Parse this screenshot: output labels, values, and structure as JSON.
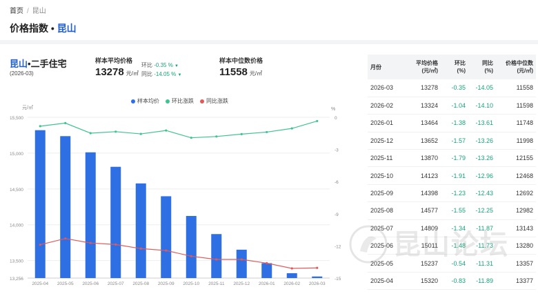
{
  "breadcrumb": {
    "home": "首页",
    "sep": "/",
    "current": "昆山"
  },
  "page_title": {
    "prefix": "价格指数 • ",
    "city": "昆山"
  },
  "city_block": {
    "city": "昆山",
    "type": "•二手住宅",
    "date": "(2026-03)"
  },
  "avg_price": {
    "label": "样本平均价格",
    "value": "13278",
    "unit": "元/㎡",
    "mom_label": "环比",
    "mom_value": "-0.35 %",
    "yoy_label": "同比",
    "yoy_value": "-14.05 %"
  },
  "median_price": {
    "label": "样本中位数价格",
    "value": "11558",
    "unit": "元/㎡"
  },
  "legend": {
    "avg": "样本均价",
    "mom": "环比涨跌",
    "yoy": "同比涨跌"
  },
  "colors": {
    "bar": "#2f6fe4",
    "mom": "#3fc38f",
    "yoy": "#e05a5a",
    "accent": "#1f5fd1"
  },
  "chart_data": {
    "type": "bar",
    "categories": [
      "2025-04",
      "2025-05",
      "2025-06",
      "2025-07",
      "2025-08",
      "2025-09",
      "2025-10",
      "2025-11",
      "2025-12",
      "2026-01",
      "2026-02",
      "2026-03"
    ],
    "series": [
      {
        "name": "样本均价",
        "type": "bar",
        "axis": "left",
        "values": [
          15320,
          15237,
          15011,
          14809,
          14577,
          14398,
          14123,
          13870,
          13652,
          13464,
          13324,
          13278
        ]
      },
      {
        "name": "环比涨跌",
        "type": "line",
        "axis": "right",
        "values": [
          -0.83,
          -0.54,
          -1.48,
          -1.34,
          -1.55,
          -1.23,
          -1.91,
          -1.79,
          -1.57,
          -1.38,
          -1.04,
          -0.35
        ]
      },
      {
        "name": "同比涨跌",
        "type": "line",
        "axis": "right",
        "values": [
          -11.89,
          -11.31,
          -11.73,
          -11.87,
          -12.25,
          -12.43,
          -12.96,
          -13.26,
          -13.26,
          -13.61,
          -14.1,
          -14.05
        ]
      }
    ],
    "left_axis": {
      "unit": "元/㎡",
      "min": 13256,
      "max": 15500,
      "ticks": [
        "15,500",
        "15,000",
        "14,500",
        "14,000",
        "13,500",
        "13,256"
      ],
      "tick_values": [
        15500,
        15000,
        14500,
        14000,
        13500,
        13256
      ]
    },
    "right_axis": {
      "unit": "%",
      "min": -15,
      "max": 0,
      "ticks": [
        "0",
        "-3",
        "-6",
        "-9",
        "-12",
        "-15"
      ],
      "tick_values": [
        0,
        -3,
        -6,
        -9,
        -12,
        -15
      ]
    }
  },
  "table": {
    "headers": [
      [
        "月份",
        ""
      ],
      [
        "平均价格",
        "(元/㎡)"
      ],
      [
        "环比",
        "(%)"
      ],
      [
        "同比",
        "(%)"
      ],
      [
        "价格中位数",
        "(元/㎡)"
      ]
    ],
    "rows": [
      [
        "2026-03",
        "13278",
        "-0.35",
        "-14.05",
        "11558"
      ],
      [
        "2026-02",
        "13324",
        "-1.04",
        "-14.10",
        "11598"
      ],
      [
        "2026-01",
        "13464",
        "-1.38",
        "-13.61",
        "11748"
      ],
      [
        "2025-12",
        "13652",
        "-1.57",
        "-13.26",
        "11998"
      ],
      [
        "2025-11",
        "13870",
        "-1.79",
        "-13.26",
        "12155"
      ],
      [
        "2025-10",
        "14123",
        "-1.91",
        "-12.96",
        "12468"
      ],
      [
        "2025-09",
        "14398",
        "-1.23",
        "-12.43",
        "12692"
      ],
      [
        "2025-08",
        "14577",
        "-1.55",
        "-12.25",
        "12982"
      ],
      [
        "2025-07",
        "14809",
        "-1.34",
        "-11.87",
        "13143"
      ],
      [
        "2025-06",
        "15011",
        "-1.48",
        "-11.73",
        "13280"
      ],
      [
        "2025-05",
        "15237",
        "-0.54",
        "-11.31",
        "13357"
      ],
      [
        "2025-04",
        "15320",
        "-0.83",
        "-11.89",
        "13377"
      ]
    ]
  },
  "watermark": {
    "text": "昆山论坛"
  }
}
